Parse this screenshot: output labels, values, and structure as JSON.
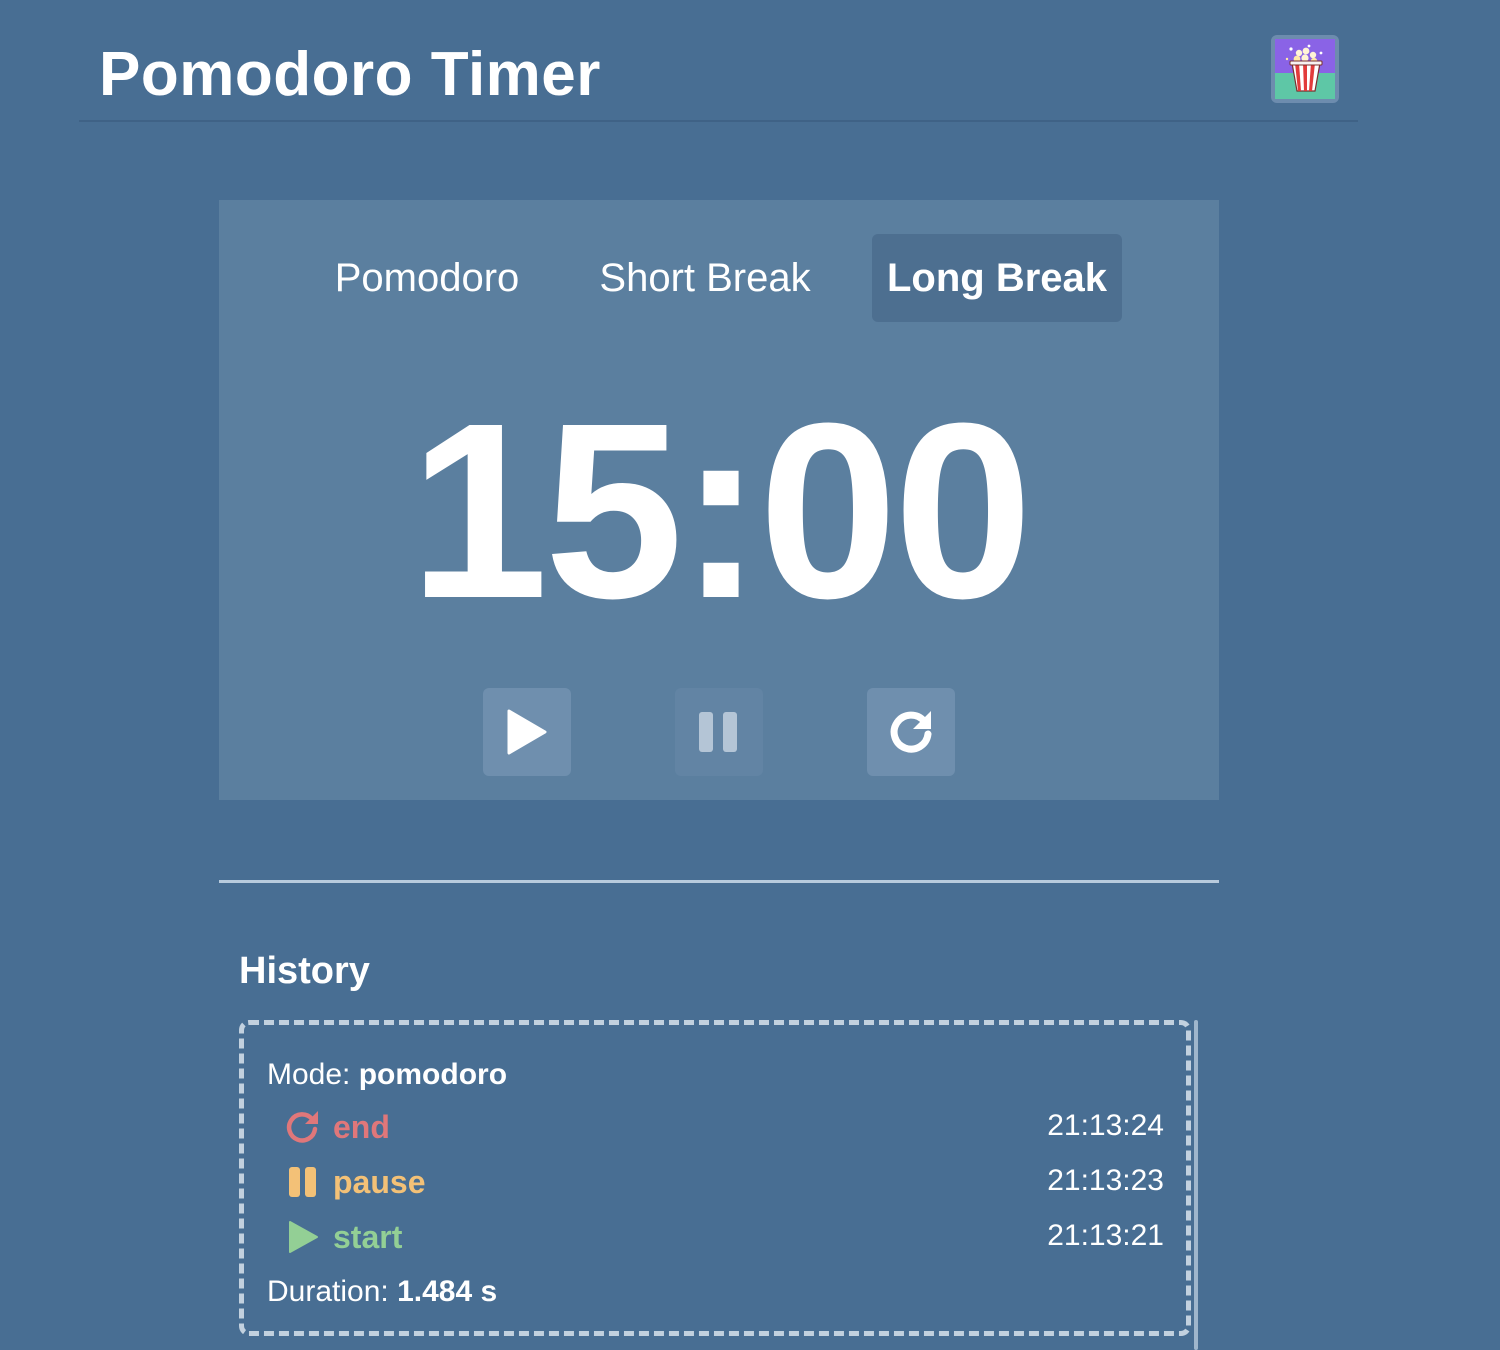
{
  "header": {
    "title": "Pomodoro Timer",
    "avatar_icon": "popcorn-icon"
  },
  "timer": {
    "tabs": [
      {
        "label": "Pomodoro",
        "active": false
      },
      {
        "label": "Short Break",
        "active": false
      },
      {
        "label": "Long Break",
        "active": true
      }
    ],
    "time": "15:00",
    "controls": {
      "play_icon": "play-icon",
      "pause_icon": "pause-icon",
      "reset_icon": "reset-icon"
    }
  },
  "history": {
    "title": "History",
    "sessions": [
      {
        "mode_label": "Mode:",
        "mode_value": "pomodoro",
        "events": [
          {
            "label": "end",
            "time": "21:13:24",
            "icon": "reset-icon",
            "color": "#e0777a"
          },
          {
            "label": "pause",
            "time": "21:13:23",
            "icon": "pause-icon",
            "color": "#f3c177"
          },
          {
            "label": "start",
            "time": "21:13:21",
            "icon": "play-icon",
            "color": "#93cf95"
          }
        ],
        "duration_label": "Duration:",
        "duration_value": "1.484 s"
      }
    ]
  },
  "colors": {
    "background": "#486e93",
    "card": "#5b7f9f",
    "active_tab": "#4d6f90"
  }
}
